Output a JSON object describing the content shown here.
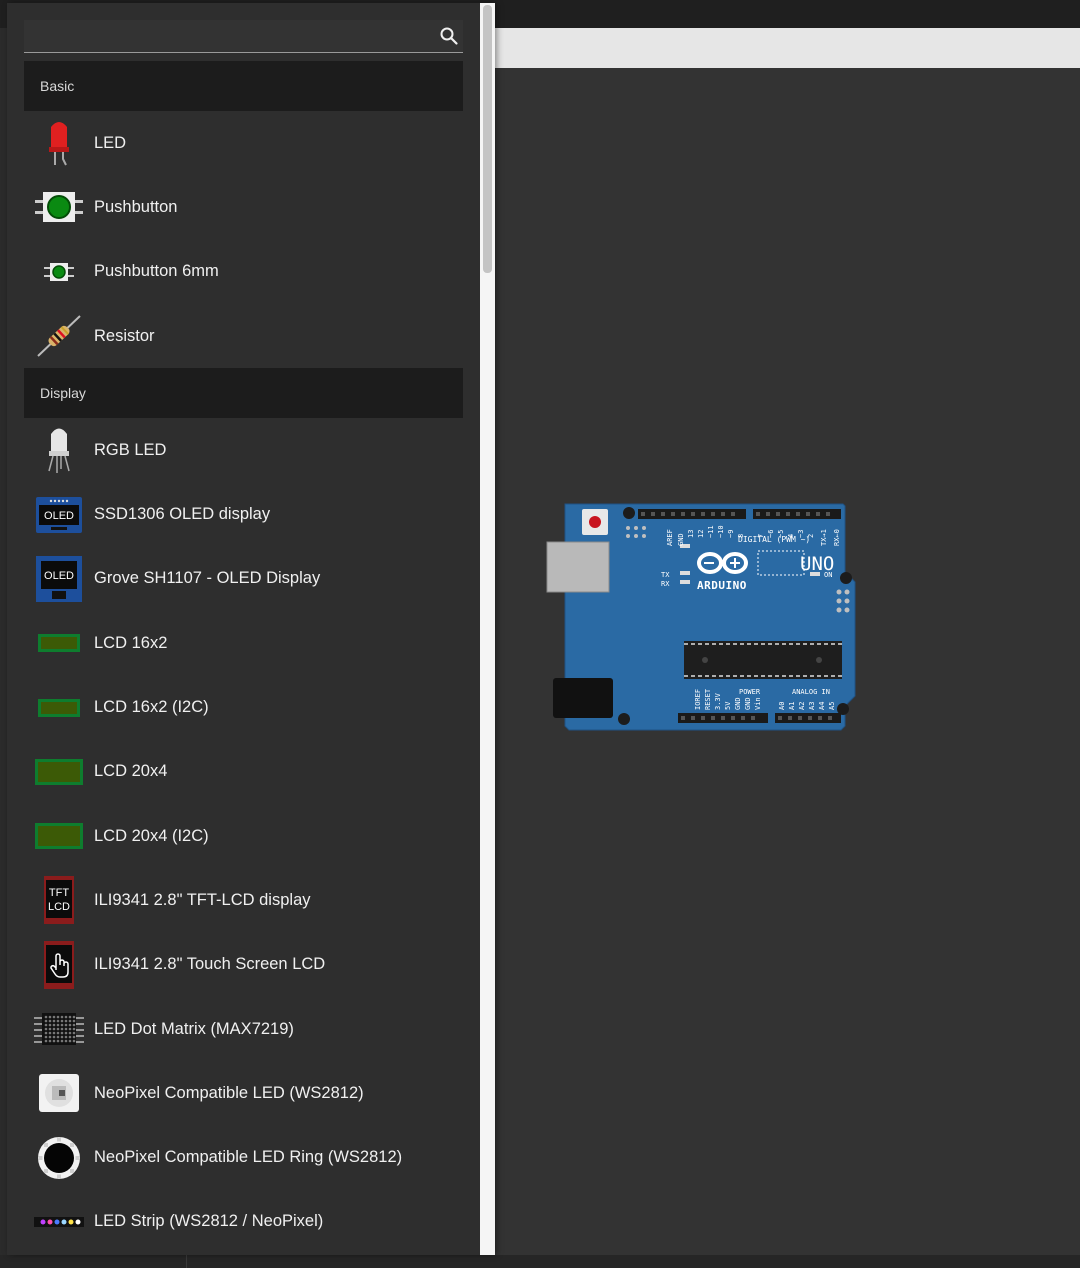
{
  "search": {
    "placeholder": "",
    "value": ""
  },
  "categories": [
    {
      "label": "Basic",
      "items": [
        {
          "label": "LED",
          "icon": "led-icon"
        },
        {
          "label": "Pushbutton",
          "icon": "pushbutton-icon"
        },
        {
          "label": "Pushbutton 6mm",
          "icon": "pushbutton-6mm-icon"
        },
        {
          "label": "Resistor",
          "icon": "resistor-icon"
        }
      ]
    },
    {
      "label": "Display",
      "items": [
        {
          "label": "RGB LED",
          "icon": "rgb-led-icon"
        },
        {
          "label": "SSD1306 OLED display",
          "icon": "oled-display-icon",
          "icon_text": "OLED"
        },
        {
          "label": "Grove SH1107 - OLED Display",
          "icon": "grove-oled-icon",
          "icon_text": "OLED"
        },
        {
          "label": "LCD 16x2",
          "icon": "lcd-16x2-icon"
        },
        {
          "label": "LCD 16x2 (I2C)",
          "icon": "lcd-16x2-i2c-icon"
        },
        {
          "label": "LCD 20x4",
          "icon": "lcd-20x4-icon"
        },
        {
          "label": "LCD 20x4 (I2C)",
          "icon": "lcd-20x4-i2c-icon"
        },
        {
          "label": "ILI9341 2.8\" TFT-LCD display",
          "icon": "tft-lcd-icon",
          "icon_text": [
            "TFT",
            "LCD"
          ]
        },
        {
          "label": "ILI9341 2.8\" Touch Screen LCD",
          "icon": "touch-screen-icon"
        },
        {
          "label": "LED Dot Matrix (MAX7219)",
          "icon": "dot-matrix-icon"
        },
        {
          "label": "NeoPixel Compatible LED (WS2812)",
          "icon": "neopixel-icon"
        },
        {
          "label": "NeoPixel Compatible LED Ring (WS2812)",
          "icon": "neopixel-ring-icon"
        },
        {
          "label": "LED Strip (WS2812 / NeoPixel)",
          "icon": "led-strip-icon"
        }
      ]
    }
  ],
  "board": {
    "model": "UNO",
    "brand": "ARDUINO",
    "labels": {
      "digital": "DIGITAL (PWM ~)",
      "power": "POWER",
      "analog": "ANALOG IN",
      "on": "ON",
      "tx": "TX",
      "rx": "RX",
      "l": "L",
      "aref": "AREF",
      "gnd": "GND",
      "top_pins": [
        "13",
        "12",
        "~11",
        "~10",
        "~9",
        "8",
        "7",
        "~6",
        "~5",
        "4",
        "~3",
        "2",
        "TX→1",
        "RX←0"
      ],
      "power_pins": [
        "IOREF",
        "RESET",
        "3.3V",
        "5V",
        "GND",
        "GND",
        "Vin"
      ],
      "analog_pins": [
        "A0",
        "A1",
        "A2",
        "A3",
        "A4",
        "A5"
      ]
    }
  },
  "colors": {
    "panel_bg": "#2e2e2e",
    "category_bg": "#1c1c1c",
    "canvas_bg": "#333333",
    "board_blue": "#2a6aa4"
  }
}
